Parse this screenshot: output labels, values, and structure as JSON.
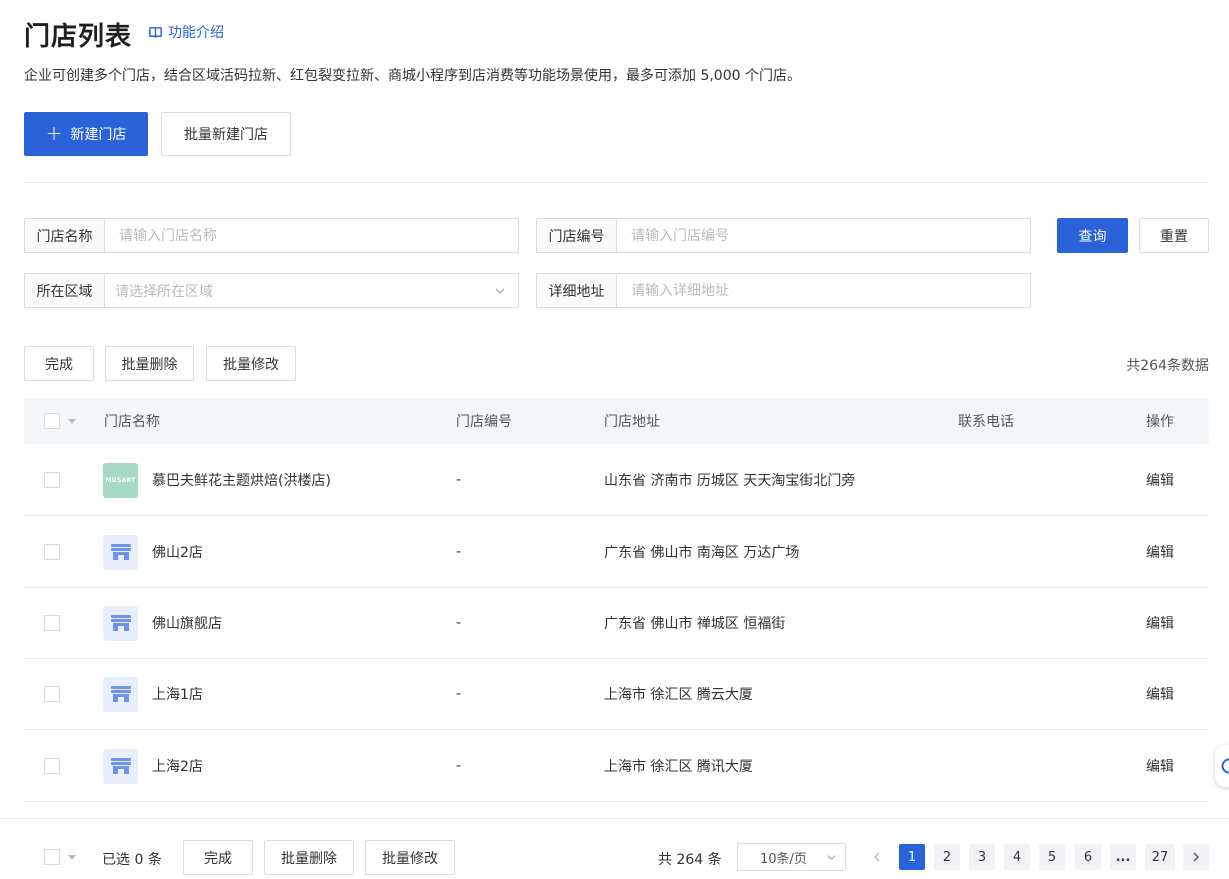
{
  "header": {
    "title": "门店列表",
    "intro_link": "功能介绍",
    "description": "企业可创建多个门店，结合区域活码拉新、红包裂变拉新、商城小程序到店消费等功能场景使用，最多可添加 5,000 个门店。"
  },
  "actions": {
    "new_store": "新建门店",
    "batch_new_store": "批量新建门店"
  },
  "filters": {
    "name": {
      "label": "门店名称",
      "placeholder": "请输入门店名称",
      "value": ""
    },
    "code": {
      "label": "门店编号",
      "placeholder": "请输入门店编号",
      "value": ""
    },
    "area": {
      "label": "所在区域",
      "placeholder": "请选择所在区域"
    },
    "address": {
      "label": "详细地址",
      "placeholder": "请输入详细地址",
      "value": ""
    },
    "query": "查询",
    "reset": "重置"
  },
  "toolbar": {
    "done": "完成",
    "batch_delete": "批量删除",
    "batch_modify": "批量修改",
    "total_text": "共264条数据"
  },
  "table": {
    "columns": [
      "门店名称",
      "门店编号",
      "门店地址",
      "联系电话",
      "操作"
    ],
    "rows": [
      {
        "name": "慕巴夫鲜花主题烘焙(洪楼店)",
        "code": "-",
        "address": "山东省 济南市 历城区 天天淘宝街北门旁",
        "phone": "",
        "action": "编辑",
        "thumb": "logo",
        "logo_text": "MUSART"
      },
      {
        "name": "佛山2店",
        "code": "-",
        "address": "广东省 佛山市 南海区 万达广场",
        "phone": "",
        "action": "编辑",
        "thumb": "store"
      },
      {
        "name": "佛山旗舰店",
        "code": "-",
        "address": "广东省 佛山市 禅城区 恒福街",
        "phone": "",
        "action": "编辑",
        "thumb": "store"
      },
      {
        "name": "上海1店",
        "code": "-",
        "address": "上海市 徐汇区 腾云大厦",
        "phone": "",
        "action": "编辑",
        "thumb": "store"
      },
      {
        "name": "上海2店",
        "code": "-",
        "address": "上海市 徐汇区 腾讯大厦",
        "phone": "",
        "action": "编辑",
        "thumb": "store"
      }
    ]
  },
  "footer": {
    "selected_text": "已选 0 条",
    "done": "完成",
    "batch_delete": "批量删除",
    "batch_modify": "批量修改",
    "total_text": "共 264 条",
    "page_size": "10条/页",
    "pages": [
      "1",
      "2",
      "3",
      "4",
      "5",
      "6",
      "...",
      "27"
    ],
    "current_page": "1"
  },
  "colors": {
    "primary": "#2a62d9",
    "header_bg": "#f3f6f9",
    "store_icon": "#6f93ea",
    "logo_bg": "#a6d9c4"
  }
}
